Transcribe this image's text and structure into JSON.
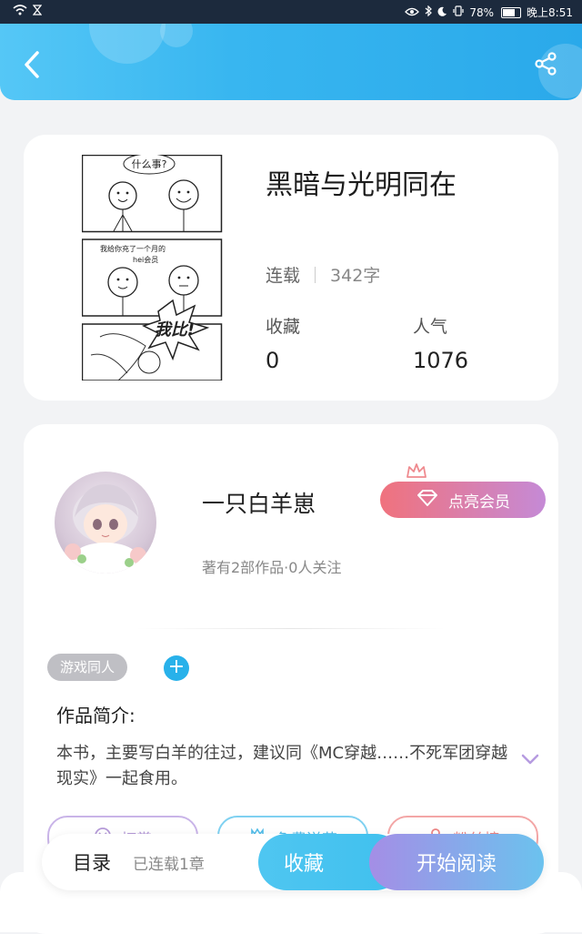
{
  "status_bar": {
    "battery": "78%",
    "time": "晚上8:51"
  },
  "book": {
    "title": "黑暗与光明同在",
    "serial_status": "连载",
    "word_count": "342字",
    "favorites_label": "收藏",
    "favorites_value": "0",
    "popularity_label": "人气",
    "popularity_value": "1076",
    "cover_texts": [
      "什么事?",
      "我给你充了一个月的",
      "hei会员",
      "我比!"
    ]
  },
  "author": {
    "name": "一只白羊崽",
    "vip_button": "点亮会员",
    "meta": "著有2部作品·0人关注"
  },
  "tags": [
    "游戏同人"
  ],
  "tag_add": "+",
  "intro": {
    "title": "作品简介:",
    "text": "本书，主要写白羊的往过，建议同《MC穿越……不死军团穿越现实》一起食用。"
  },
  "actions": [
    "打赏",
    "免费送花",
    "粉丝榜"
  ],
  "bottom_bar": {
    "toc": "目录",
    "chapters": "已连载1章",
    "favorite": "收藏",
    "read": "开始阅读"
  },
  "colors": {
    "header": "#38b6f0",
    "accent": "#28b1ea",
    "vip_start": "#f0727d",
    "vip_end": "#c58ad6"
  }
}
